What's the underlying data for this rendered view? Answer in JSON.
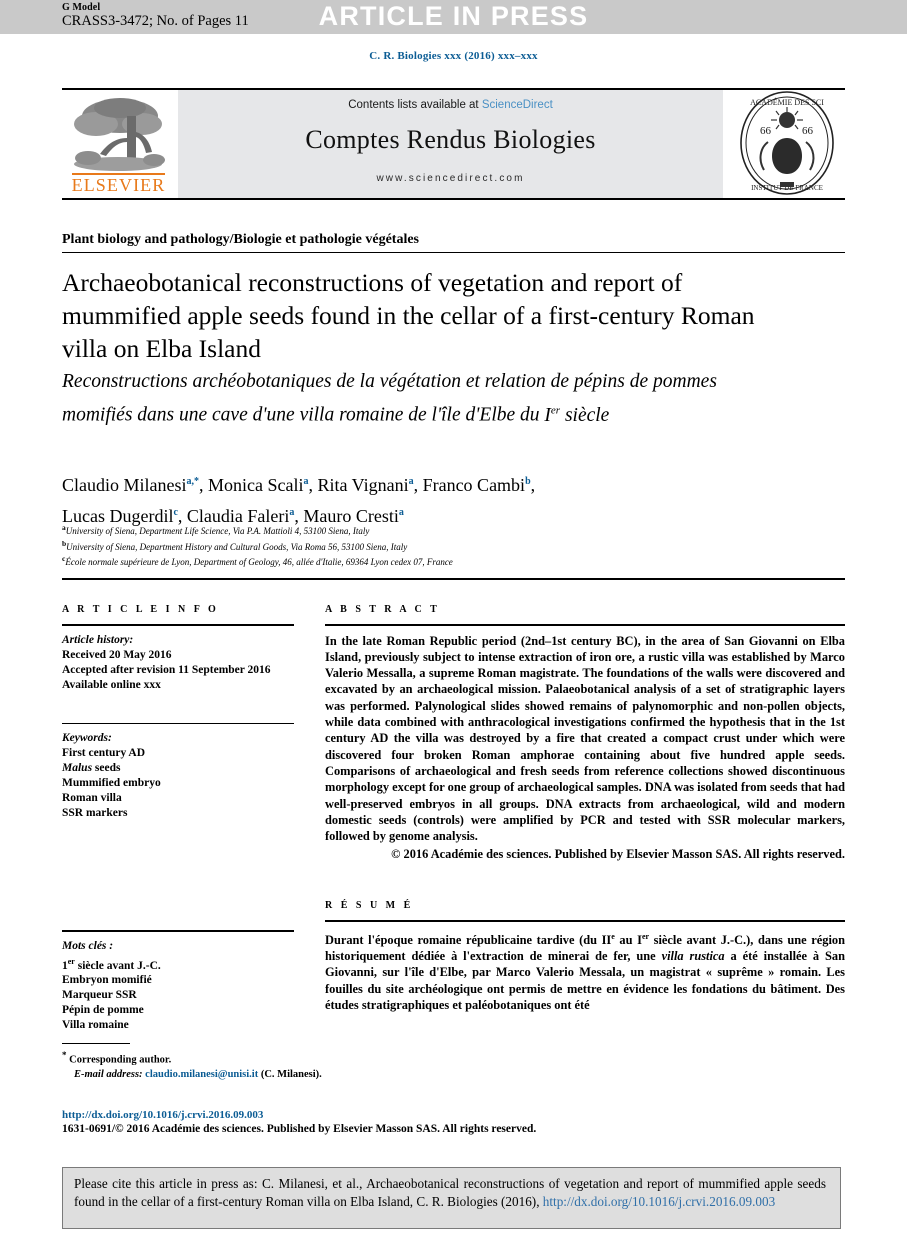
{
  "header": {
    "g_model": "G Model",
    "article_id": "CRASS3-3472; No. of Pages 11",
    "banner": "ARTICLE IN PRESS",
    "journal_ref": "C. R. Biologies xxx (2016) xxx–xxx"
  },
  "masthead": {
    "contents_prefix": "Contents lists available at ",
    "sciencedirect": "ScienceDirect",
    "journal_title": "Comptes Rendus Biologies",
    "url": "www.sciencedirect.com",
    "publisher_logo_text": "ELSEVIER",
    "publisher_logo_icon": "elsevier-tree-icon",
    "seal_icon": "academie-des-sciences-seal-icon",
    "accent_orange": "#e8791a",
    "accent_blue": "#0b5c94",
    "band_gray": "#e6e7e9"
  },
  "article": {
    "section": "Plant biology and pathology/Biologie et pathologie végétales",
    "title_en": "Archaeobotanical reconstructions of vegetation and report of mummified apple seeds found in the cellar of a first-century Roman villa on Elba Island",
    "title_fr_line1": "Reconstructions archéobotaniques de la végétation et relation de pépins",
    "title_fr_line2": "de pommes momifiés dans une cave d'une villa romaine de l'île d'Elbe du",
    "title_fr_line3_main": "I",
    "title_fr_line3_sup": "er",
    "title_fr_line3_rest": " siècle"
  },
  "authors": [
    {
      "name": "Claudio Milanesi",
      "marks": "a,*"
    },
    {
      "name": "Monica Scali",
      "marks": "a"
    },
    {
      "name": "Rita Vignani",
      "marks": "a"
    },
    {
      "name": "Franco Cambi",
      "marks": "b"
    },
    {
      "name": "Lucas Dugerdil",
      "marks": "c"
    },
    {
      "name": "Claudia Faleri",
      "marks": "a"
    },
    {
      "name": "Mauro Cresti",
      "marks": "a"
    }
  ],
  "affiliations": [
    {
      "mark": "a",
      "text": "University of Siena, Department Life Science, Via P.A. Mattioli 4, 53100 Siena, Italy"
    },
    {
      "mark": "b",
      "text": "University of Siena, Department History and Cultural Goods, Via Roma 56, 53100 Siena, Italy"
    },
    {
      "mark": "c",
      "text": "École normale supérieure de Lyon, Department of Geology, 46, allée d'Italie, 69364 Lyon cedex 07, France"
    }
  ],
  "article_info": {
    "heading": "A R T I C L E   I N F O",
    "history_label": "Article history:",
    "history": [
      "Received 20 May 2016",
      "Accepted after revision 11 September 2016",
      "Available online xxx"
    ],
    "keywords_label": "Keywords:",
    "keywords": [
      "First century AD",
      "Malus seeds",
      "Mummified embryo",
      "Roman villa",
      "SSR markers"
    ],
    "mots_label": "Mots clés :",
    "mots": [
      "1er siècle avant J.-C.",
      "Embryon momifié",
      "Marqueur SSR",
      "Pépin de pomme",
      "Villa romaine"
    ]
  },
  "abstract": {
    "heading": "A B S T R A C T",
    "body": "In the late Roman Republic period (2nd–1st century BC), in the area of San Giovanni on Elba Island, previously subject to intense extraction of iron ore, a rustic villa was established by Marco Valerio Messalla, a supreme Roman magistrate. The foundations of the walls were discovered and excavated by an archaeological mission. Palaeobotanical analysis of a set of stratigraphic layers was performed. Palynological slides showed remains of palynomorphic and non-pollen objects, while data combined with anthracological investigations confirmed the hypothesis that in the 1st century AD the villa was destroyed by a fire that created a compact crust under which were discovered four broken Roman amphorae containing about five hundred apple seeds. Comparisons of archaeological and fresh seeds from reference collections showed discontinuous morphology except for one group of archaeological samples. DNA was isolated from seeds that had well-preserved embryos in all groups. DNA extracts from archaeological, wild and modern domestic seeds (controls) were amplified by PCR and tested with SSR molecular markers, followed by genome analysis.",
    "copyright": "© 2016 Académie des sciences. Published by Elsevier Masson SAS. All rights reserved."
  },
  "resume": {
    "heading": "R É S U M É",
    "part1": "Durant l'époque romaine républicaine tardive (du II",
    "sup1": "e",
    "part2": " au I",
    "sup2": "er",
    "part3": " siècle avant J.-C.), dans une région historiquement dédiée à l'extraction de minerai de fer, une ",
    "italic1": "villa rustica",
    "part4": " a été installée à San Giovanni, sur l'île d'Elbe, par Marco Valerio Messala, un magistrat « suprême » romain. Les fouilles du site archéologique ont permis de mettre en évidence les fondations du bâtiment. Des études stratigraphiques et paléobotaniques ont été"
  },
  "footnote": {
    "star": "*",
    "corresponding": "Corresponding author.",
    "email_label": "E-mail address:",
    "email": "claudio.milanesi@unisi.it",
    "email_owner": "(C. Milanesi)."
  },
  "footer": {
    "doi": "http://dx.doi.org/10.1016/j.crvi.2016.09.003",
    "copyright": "1631-0691/© 2016 Académie des sciences. Published by Elsevier Masson SAS. All rights reserved."
  },
  "cite_box": {
    "text": "Please cite this article in press as: C. Milanesi, et al., Archaeobotanical reconstructions of vegetation and report of mummified apple seeds found in the cellar of a first-century Roman villa on Elba Island, C. R. Biologies (2016), ",
    "link": "http://dx.doi.org/10.1016/j.crvi.2016.09.003"
  }
}
